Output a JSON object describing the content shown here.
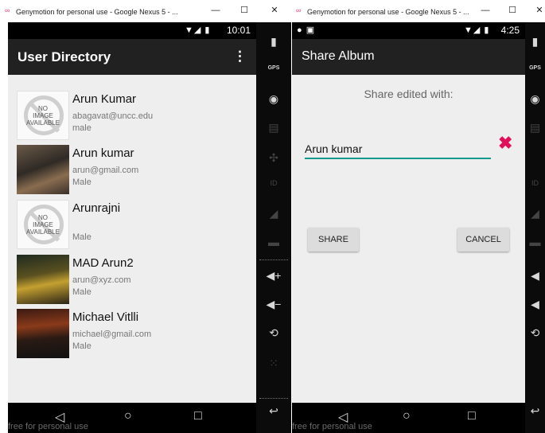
{
  "colors": {
    "accent": "#129a8e",
    "appbar": "#212121",
    "clear": "#e0105a",
    "window_icon": "#e8457a"
  },
  "left_window": {
    "title": "Genymotion for personal use - Google Nexus 5 - ...",
    "controls": {
      "minimize": "—",
      "maximize": "☐",
      "close": "✕"
    },
    "status": {
      "time": "10:01"
    },
    "app": {
      "title": "User Directory",
      "menu_icon": "⋮"
    },
    "no_image_text": "NO\nIMAGE\nAVAILABLE",
    "users": [
      {
        "name": "Arun Kumar",
        "email": "abagavat@uncc.edu",
        "gender": "male",
        "thumb": "no-image"
      },
      {
        "name": "Arun kumar",
        "email": "arun@gmail.com",
        "gender": "Male",
        "thumb": "photo"
      },
      {
        "name": "Arunrajni",
        "email": "",
        "gender": "Male",
        "thumb": "no-image"
      },
      {
        "name": "MAD Arun2",
        "email": "arun@xyz.com",
        "gender": "Male",
        "thumb": "photo"
      },
      {
        "name": "Michael Vitlli",
        "email": "michael@gmail.com",
        "gender": "Male",
        "thumb": "photo"
      }
    ],
    "watermark": "free for personal use"
  },
  "right_window": {
    "title": "Genymotion for personal use - Google Nexus 5 - ...",
    "controls": {
      "minimize": "—",
      "maximize": "☐",
      "close": "✕"
    },
    "status": {
      "time": "4:25"
    },
    "app": {
      "title": "Share Album"
    },
    "share_label": "Share edited with:",
    "input_value": "Arun kumar",
    "clear_icon": "✖",
    "share_button": "SHARE",
    "cancel_button": "CANCEL",
    "watermark": "free for personal use"
  },
  "sidebar": {
    "gps_label": "GPS",
    "id_label": "ID"
  }
}
